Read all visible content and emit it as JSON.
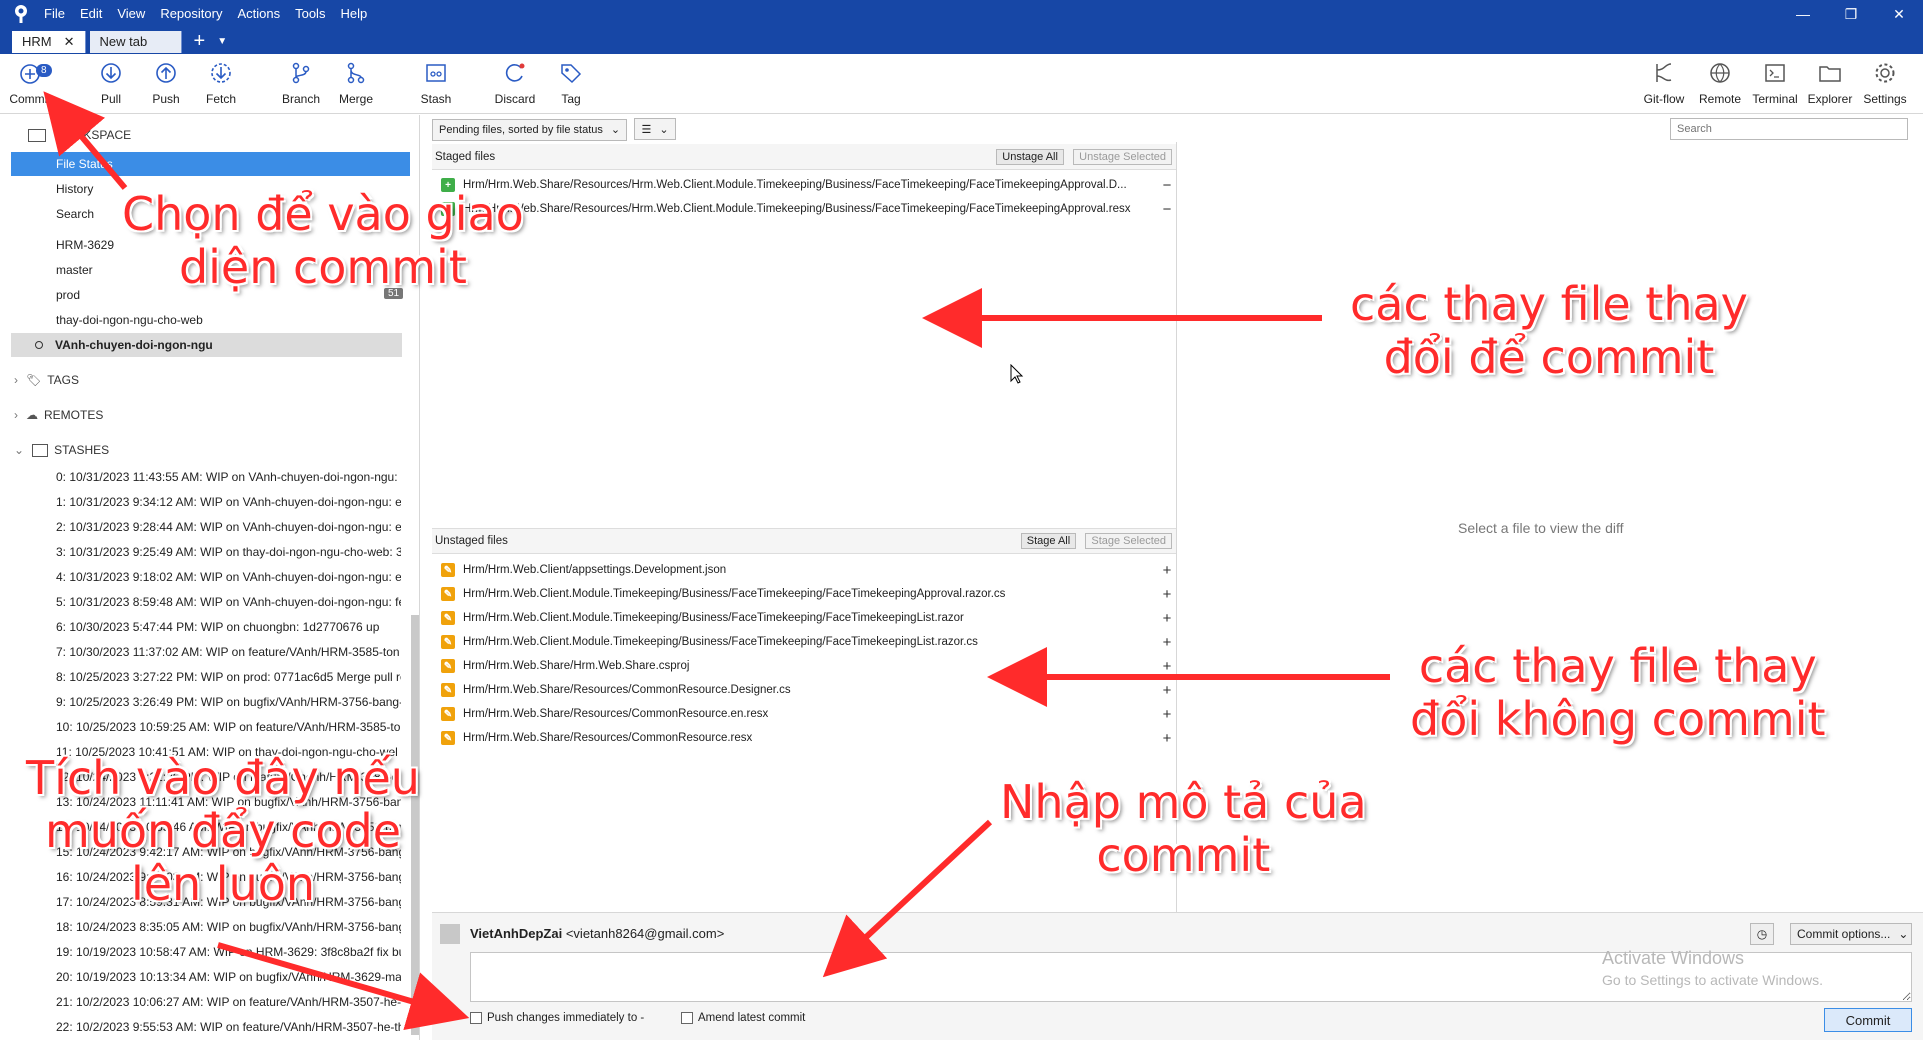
{
  "menu": [
    "File",
    "Edit",
    "View",
    "Repository",
    "Actions",
    "Tools",
    "Help"
  ],
  "tabs": {
    "active": "HRM",
    "other": "New tab"
  },
  "toolbar": {
    "commit": "Commit",
    "commit_badge": "8",
    "pull": "Pull",
    "push": "Push",
    "fetch": "Fetch",
    "branch": "Branch",
    "merge": "Merge",
    "stash": "Stash",
    "discard": "Discard",
    "tag": "Tag",
    "gitflow": "Git-flow",
    "remote": "Remote",
    "terminal": "Terminal",
    "explorer": "Explorer",
    "settings": "Settings"
  },
  "sidebar": {
    "workspace": "WORKSPACE",
    "file_status": "File Status",
    "history": "History",
    "search": "Search",
    "branches": [
      "HRM-3629",
      "master",
      "prod",
      "thay-doi-ngon-ngu-cho-web",
      "VAnh-chuyen-doi-ngon-ngu"
    ],
    "prod_count": "51",
    "tags": "TAGS",
    "remotes": "REMOTES",
    "stashes_head": "STASHES",
    "stashes": [
      "0: 10/31/2023 11:43:55 AM: WIP on VAnh-chuyen-doi-ngon-ngu:",
      "1: 10/31/2023 9:34:12 AM: WIP on VAnh-chuyen-doi-ngon-ngu: e",
      "2: 10/31/2023 9:28:44 AM: WIP on VAnh-chuyen-doi-ngon-ngu: e",
      "3: 10/31/2023 9:25:49 AM: WIP on thay-doi-ngon-ngu-cho-web: 3",
      "4: 10/31/2023 9:18:02 AM: WIP on VAnh-chuyen-doi-ngon-ngu: e",
      "5: 10/31/2023 8:59:48 AM: WIP on VAnh-chuyen-doi-ngon-ngu: fe",
      "6: 10/30/2023 5:47:44 PM: WIP on chuongbn: 1d2770676 up",
      "7: 10/30/2023 11:37:02 AM: WIP on feature/VAnh/HRM-3585-ton",
      "8: 10/25/2023 3:27:22 PM: WIP on prod: 0771ac6d5 Merge pull re",
      "9: 10/25/2023 3:26:49 PM: WIP on bugfix/VAnh/HRM-3756-bang-",
      "10: 10/25/2023 10:59:25 AM: WIP on feature/VAnh/HRM-3585-to",
      "11: 10/25/2023 10:41:51 AM: WIP on thay-doi-ngon-ngu-cho-wel",
      "12: 10/24/2023 5:21:26 PM: WIP on feature/Chenh/HRM-3788-di",
      "13: 10/24/2023 11:11:41 AM: WIP on bugfix/VAnh/HRM-3756-bang",
      "14: 10/24/2023 10:55:46 AM: WIP on bugfix/VAnh/HRM-3756-bang",
      "15: 10/24/2023 9:42:17 AM: WIP on bugfix/VAnh/HRM-3756-bang",
      "16: 10/24/2023 9:14:03 AM: WIP on bugfix/VAnh/HRM-3756-bang",
      "17: 10/24/2023 8:59:31 AM: WIP on bugfix/VAnh/HRM-3756-bang",
      "18: 10/24/2023 8:35:05 AM: WIP on bugfix/VAnh/HRM-3756-bang",
      "19: 10/19/2023 10:58:47 AM: WIP on HRM-3629: 3f8c8ba2f fix bu",
      "20: 10/19/2023 10:13:34 AM: WIP on bugfix/VAnh/HRM-3629-ma",
      "21: 10/2/2023 10:06:27 AM: WIP on feature/VAnh/HRM-3507-he-",
      "22: 10/2/2023 9:55:53 AM: WIP on feature/VAnh/HRM-3507-he-th"
    ]
  },
  "filter": {
    "pending": "Pending files, sorted by file status",
    "view_icon": "list-icon"
  },
  "staged": {
    "title": "Staged files",
    "unstage_all": "Unstage All",
    "unstage_selected": "Unstage Selected",
    "files": [
      "Hrm/Hrm.Web.Share/Resources/Hrm.Web.Client.Module.Timekeeping/Business/FaceTimekeeping/FaceTimekeepingApproval.D...",
      "Hrm/Hrm.Web.Share/Resources/Hrm.Web.Client.Module.Timekeeping/Business/FaceTimekeeping/FaceTimekeepingApproval.resx"
    ]
  },
  "unstaged": {
    "title": "Unstaged files",
    "stage_all": "Stage All",
    "stage_selected": "Stage Selected",
    "files": [
      "Hrm/Hrm.Web.Client/appsettings.Development.json",
      "Hrm/Hrm.Web.Client.Module.Timekeeping/Business/FaceTimekeeping/FaceTimekeepingApproval.razor.cs",
      "Hrm/Hrm.Web.Client.Module.Timekeeping/Business/FaceTimekeeping/FaceTimekeepingList.razor",
      "Hrm/Hrm.Web.Client.Module.Timekeeping/Business/FaceTimekeeping/FaceTimekeepingList.razor.cs",
      "Hrm/Hrm.Web.Share/Hrm.Web.Share.csproj",
      "Hrm/Hrm.Web.Share/Resources/CommonResource.Designer.cs",
      "Hrm/Hrm.Web.Share/Resources/CommonResource.en.resx",
      "Hrm/Hrm.Web.Share/Resources/CommonResource.resx"
    ]
  },
  "diff": {
    "placeholder": "Select a file to view the diff",
    "search_placeholder": "Search"
  },
  "commit": {
    "author": "VietAnhDepZai",
    "email": "<vietanh8264@gmail.com>",
    "options": "Commit options...",
    "push_label": "Push changes immediately to -",
    "amend_label": "Amend latest commit",
    "button": "Commit",
    "watermark_title": "Activate Windows",
    "watermark_sub": "Go to Settings to activate Windows."
  },
  "annotations": {
    "a1_l1": "Chọn để vào giao",
    "a1_l2": "diện commit",
    "a2_l1": "các thay file thay",
    "a2_l2": "đổi để commit",
    "a3_l1": "các thay file thay",
    "a3_l2": "đổi không commit",
    "a4_l1": "Nhập mô tả của",
    "a4_l2": "commit",
    "a5_l1": "Tích vào đây nếu",
    "a5_l2": "muốn đẩy code",
    "a5_l3": "lên luôn",
    "color": "#ff2b2b"
  }
}
